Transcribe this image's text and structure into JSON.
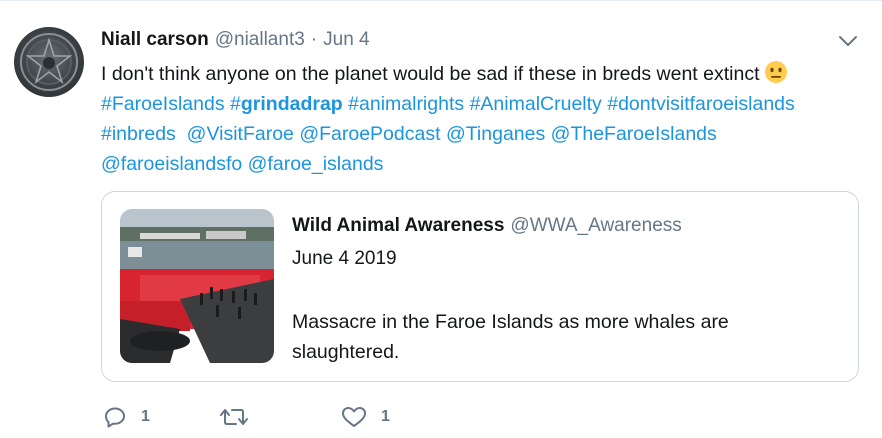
{
  "tweet": {
    "author_name": "Niall carson",
    "author_handle": "@niallant3",
    "separator": "·",
    "date": "Jun 4",
    "text_line1_plain": "I don't think anyone on the planet would be sad if these in breds went extinct",
    "emoji": "neutral-face-emoji",
    "hashtags_line2": [
      {
        "prefix": "#",
        "word": "FaroeIslands",
        "bold": false
      },
      {
        "prefix": "#",
        "word": "grindadrap",
        "bold": true
      },
      {
        "prefix": "#",
        "word": "animalrights",
        "bold": false
      },
      {
        "prefix": "#",
        "word": "AnimalCruelty",
        "bold": false
      },
      {
        "prefix": "#",
        "word": "dontvisitfaroeislands",
        "bold": false
      }
    ],
    "line3": [
      "#inbreds",
      "@VisitFaroe",
      "@FaroePodcast",
      "@Tinganes",
      "@TheFaroeIslands"
    ],
    "line4": [
      "@faroeislandsfo",
      "@faroe_islands"
    ]
  },
  "quoted": {
    "author_name": "Wild Animal Awareness",
    "author_handle": "@WWA_Awareness",
    "date": "June 4 2019",
    "body": "Massacre in the Faroe Islands as more whales are slaughtered."
  },
  "actions": {
    "reply_count": "1",
    "retweet_count": "",
    "like_count": "1"
  },
  "colors": {
    "link": "#1b95e0",
    "secondary_text": "#657786",
    "primary_text": "#14171a",
    "border": "#ccd6dd"
  },
  "icons": {
    "caret": "chevron-down-icon",
    "reply": "reply-icon",
    "retweet": "retweet-icon",
    "like": "heart-icon"
  }
}
